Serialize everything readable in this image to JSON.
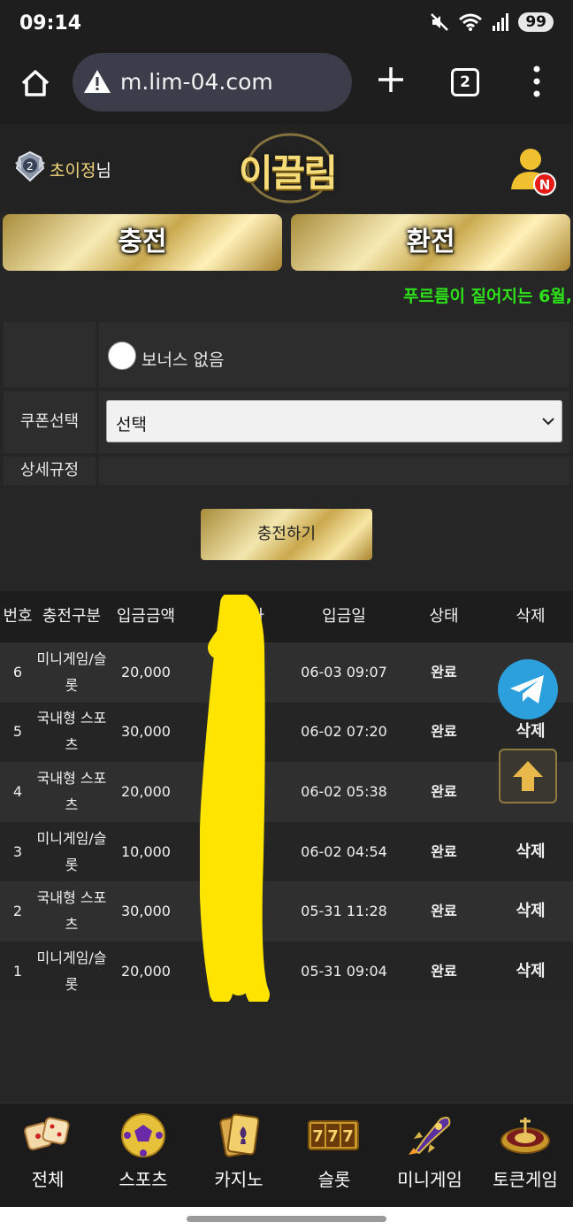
{
  "status_bar": {
    "time": "09:14",
    "battery": "99"
  },
  "browser": {
    "url": "m.lim-04.com",
    "tab_count": "2"
  },
  "header": {
    "user_nick": "초이정",
    "user_suffix": "님",
    "logo_text": "이끌림"
  },
  "main_buttons": {
    "deposit": "충전",
    "withdraw": "환전"
  },
  "marquee": "푸르름이 짙어지는 6월,",
  "form": {
    "bonus_option": "보너스 없음",
    "coupon_label": "쿠폰선택",
    "coupon_selected": "선택",
    "rules_label": "상세규정",
    "submit": "충전하기"
  },
  "history": {
    "columns": [
      "번호",
      "충전구분",
      "입금금액",
      "입금자",
      "입금일",
      "상태",
      "삭제"
    ],
    "rows": [
      {
        "no": "6",
        "type_line1": "미니게임/슬",
        "type_line2": "롯",
        "amount": "20,000",
        "date": "06-03 09:07",
        "status": "완료",
        "delete": ""
      },
      {
        "no": "5",
        "type_line1": "국내형 스포",
        "type_line2": "츠",
        "amount": "30,000",
        "date": "06-02 07:20",
        "status": "완료",
        "delete": "삭제"
      },
      {
        "no": "4",
        "type_line1": "국내형 스포",
        "type_line2": "츠",
        "amount": "20,000",
        "date": "06-02 05:38",
        "status": "완료",
        "delete": ""
      },
      {
        "no": "3",
        "type_line1": "미니게임/슬",
        "type_line2": "롯",
        "amount": "10,000",
        "date": "06-02 04:54",
        "status": "완료",
        "delete": "삭제"
      },
      {
        "no": "2",
        "type_line1": "국내형 스포",
        "type_line2": "츠",
        "amount": "30,000",
        "date": "05-31 11:28",
        "status": "완료",
        "delete": "삭제"
      },
      {
        "no": "1",
        "type_line1": "미니게임/슬",
        "type_line2": "롯",
        "amount": "20,000",
        "date": "05-31 09:04",
        "status": "완료",
        "delete": "삭제"
      }
    ]
  },
  "bottom_nav": [
    {
      "label": "전체",
      "icon": "dice-icon"
    },
    {
      "label": "스포츠",
      "icon": "soccer-ball-icon"
    },
    {
      "label": "카지노",
      "icon": "playing-cards-icon"
    },
    {
      "label": "슬롯",
      "icon": "slot-777-icon"
    },
    {
      "label": "미니게임",
      "icon": "rocket-icon"
    },
    {
      "label": "토큰게임",
      "icon": "roulette-icon"
    }
  ],
  "colors": {
    "gold": "#e7cf7c",
    "marquee_green": "#2ee21a",
    "telegram_blue": "#2ba0dc",
    "highlight_yellow": "#ffe400"
  }
}
